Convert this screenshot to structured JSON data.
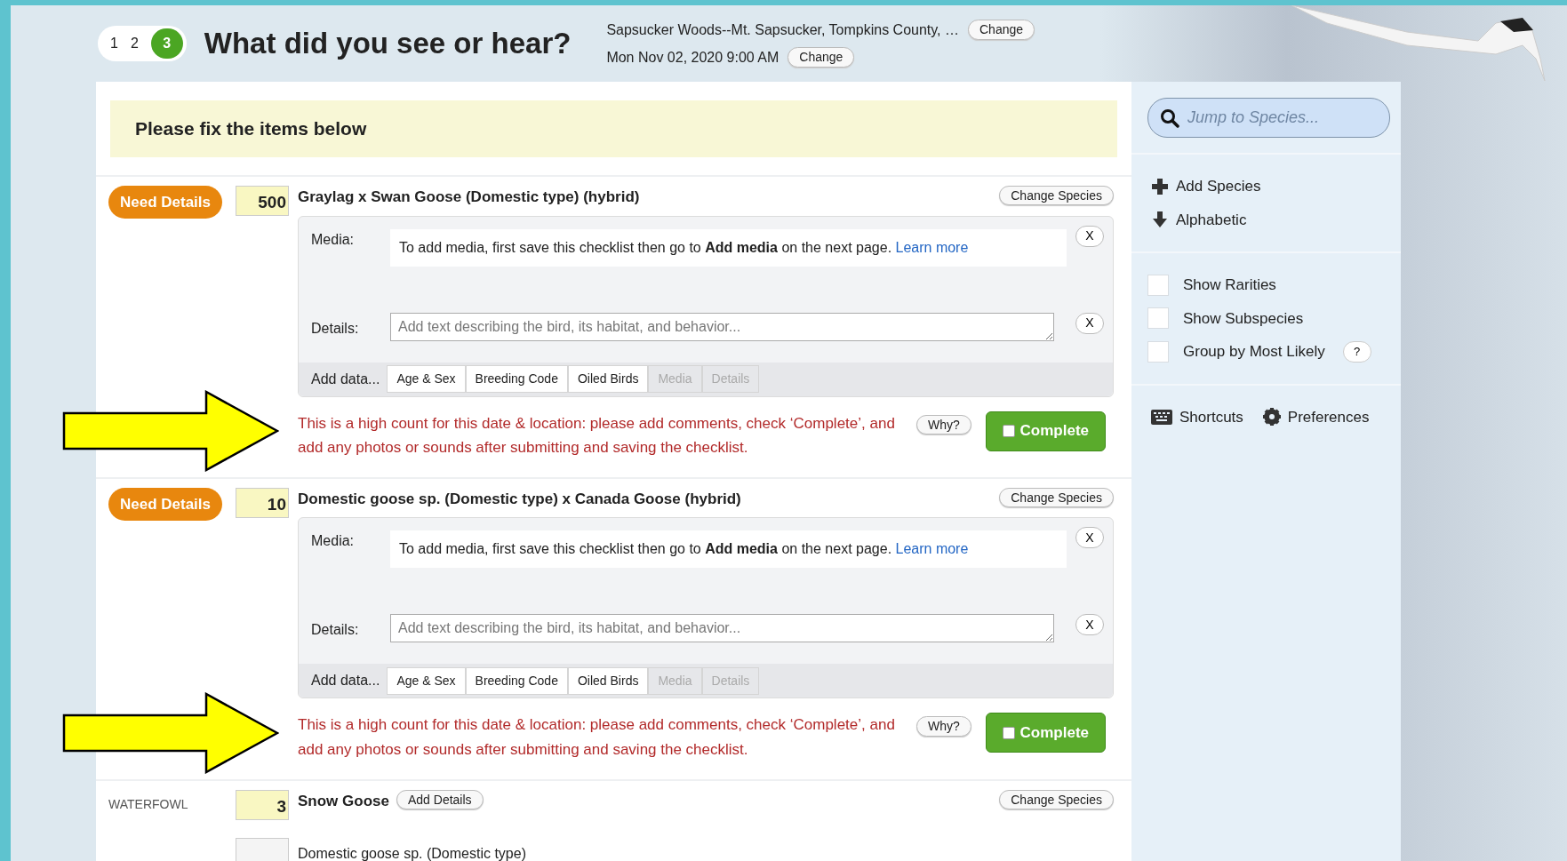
{
  "steps": [
    {
      "label": "1",
      "selected": false
    },
    {
      "label": "2",
      "selected": false
    },
    {
      "label": "3",
      "selected": true
    }
  ],
  "title": "What did you see or hear?",
  "location": {
    "text": "Sapsucker Woods--Mt. Sapsucker, Tompkins County, …",
    "button": "Change"
  },
  "date": {
    "text": "Mon Nov 02, 2020 9:00 AM",
    "button": "Change"
  },
  "alert": "Please fix the items below",
  "entries": [
    {
      "kind": "flagged",
      "highlighted": true,
      "status": "Need Details",
      "count": "500",
      "species": "Graylag x Swan Goose (Domestic type) (hybrid)",
      "change_button": "Change Species",
      "media_label": "Media:",
      "media_note": "To add media, first save this checklist then go to **Add media** on the next page.",
      "media_link": "Learn more",
      "media_close": "X",
      "details_label": "Details:",
      "details_placeholder": "Add text describing the bird, its habitat, and behavior...",
      "details_close": "X",
      "add_data_label": "Add data...",
      "add_data_tabs": [
        {
          "label": "Age & Sex",
          "disabled": false
        },
        {
          "label": "Breeding Code",
          "disabled": false
        },
        {
          "label": "Oiled Birds",
          "disabled": false
        },
        {
          "label": "Media",
          "disabled": true
        },
        {
          "label": "Details",
          "disabled": true
        }
      ],
      "warning": "This is a high count for this date & location: please add comments, check ‘Complete’, and add any photos or sounds after submitting and saving the checklist.",
      "why_button": "Why?",
      "complete": {
        "label": "Complete",
        "checked": false
      }
    },
    {
      "kind": "flagged",
      "highlighted": true,
      "status": "Need Details",
      "count": "10",
      "species": "Domestic goose sp. (Domestic type) x Canada Goose (hybrid)",
      "change_button": "Change Species",
      "media_label": "Media:",
      "media_note": "To add media, first save this checklist then go to **Add media** on the next page.",
      "media_link": "Learn more",
      "media_close": "X",
      "details_label": "Details:",
      "details_placeholder": "Add text describing the bird, its habitat, and behavior...",
      "details_close": "X",
      "add_data_label": "Add data...",
      "add_data_tabs": [
        {
          "label": "Age & Sex",
          "disabled": false
        },
        {
          "label": "Breeding Code",
          "disabled": false
        },
        {
          "label": "Oiled Birds",
          "disabled": false
        },
        {
          "label": "Media",
          "disabled": true
        },
        {
          "label": "Details",
          "disabled": true
        }
      ],
      "warning": "This is a high count for this date & location: please add comments, check ‘Complete’, and add any photos or sounds after submitting and saving the checklist.",
      "why_button": "Why?",
      "complete": {
        "label": "Complete",
        "checked": false
      }
    },
    {
      "kind": "species",
      "group": "WATERFOWL",
      "count": "3",
      "species": "Snow Goose",
      "add_details_button": "Add Details",
      "change_button": "Change Species"
    },
    {
      "kind": "plain",
      "species": "Domestic goose sp. (Domestic type)"
    }
  ],
  "sidebar": {
    "search_placeholder": "Jump to Species...",
    "actions": [
      {
        "kind": "plus",
        "label": "Add Species"
      },
      {
        "kind": "down",
        "label": "Alphabetic"
      }
    ],
    "options": [
      {
        "label": "Show Rarities",
        "checked": false
      },
      {
        "label": "Show Subspecies",
        "checked": false
      },
      {
        "label": "Group by Most Likely",
        "checked": false,
        "help": "?"
      }
    ],
    "tools": [
      {
        "kind": "keyboard",
        "label": "Shortcuts"
      },
      {
        "kind": "gear",
        "label": "Preferences"
      }
    ]
  }
}
